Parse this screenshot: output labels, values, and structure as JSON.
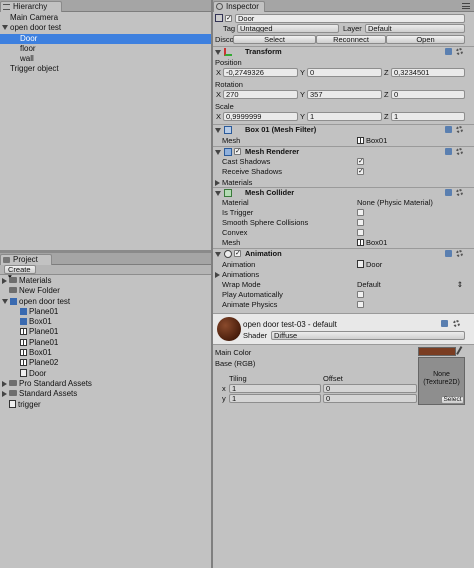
{
  "hierarchy": {
    "tab": "Hierarchy",
    "items": [
      {
        "label": "Main Camera"
      },
      {
        "label": "open door test"
      },
      {
        "label": "Door"
      },
      {
        "label": "floor"
      },
      {
        "label": "wall"
      },
      {
        "label": "Trigger object"
      }
    ]
  },
  "project": {
    "tab": "Project",
    "create_label": "Create",
    "items": [
      {
        "label": "Materials"
      },
      {
        "label": "New Folder"
      },
      {
        "label": "open door test"
      },
      {
        "label": "Plane01"
      },
      {
        "label": "Box01"
      },
      {
        "label": "Plane01"
      },
      {
        "label": "Plane01"
      },
      {
        "label": "Box01"
      },
      {
        "label": "Plane02"
      },
      {
        "label": "Door"
      },
      {
        "label": "Pro Standard Assets"
      },
      {
        "label": "Standard Assets"
      },
      {
        "label": "trigger"
      }
    ]
  },
  "inspector": {
    "tab": "Inspector",
    "object_name": "Door",
    "tag_label": "Tag",
    "tag_value": "Untagged",
    "layer_label": "Layer",
    "layer_value": "Default",
    "discon_label": "Discor",
    "select_btn": "Select",
    "reconnect_btn": "Reconnect",
    "open_btn": "Open",
    "transform": {
      "title": "Transform",
      "position_label": "Position",
      "rotation_label": "Rotation",
      "scale_label": "Scale",
      "x": "X",
      "y": "Y",
      "z": "Z",
      "pos_x": "-0,2749326",
      "pos_y": "0",
      "pos_z": "0,3234501",
      "rot_x": "270",
      "rot_y": "357",
      "rot_z": "0",
      "scl_x": "0,9999999",
      "scl_y": "1",
      "scl_z": "1"
    },
    "mesh_filter": {
      "title": "Box 01 (Mesh Filter)",
      "mesh_label": "Mesh",
      "mesh_value": "Box01"
    },
    "mesh_renderer": {
      "title": "Mesh Renderer",
      "cast_label": "Cast Shadows",
      "cast_check": "✓",
      "receive_label": "Receive Shadows",
      "receive_check": "✓",
      "materials_label": "Materials"
    },
    "mesh_collider": {
      "title": "Mesh Collider",
      "material_label": "Material",
      "material_value": "None (Physic Material)",
      "trigger_label": "Is Trigger",
      "smooth_label": "Smooth Sphere Collisions",
      "convex_label": "Convex",
      "mesh_label": "Mesh",
      "mesh_value": "Box01"
    },
    "animation": {
      "title": "Animation",
      "animation_label": "Animation",
      "animation_value": "Door",
      "animations_label": "Animations",
      "wrap_label": "Wrap Mode",
      "wrap_value": "Default",
      "play_label": "Play Automatically",
      "physics_label": "Animate Physics"
    },
    "material": {
      "title": "open door test-03 - default",
      "shader_label": "Shader",
      "shader_value": "Diffuse",
      "main_color_label": "Main Color",
      "main_color_hex": "#7a3d22",
      "base_label": "Base (RGB)",
      "tiling_label": "Tiling",
      "offset_label": "Offset",
      "x": "x",
      "y": "y",
      "tiling_x": "1",
      "tiling_y": "1",
      "offset_x": "0",
      "offset_y": "0",
      "tex_none": "None",
      "tex_type": "(Texture2D)",
      "tex_select": "Select"
    }
  },
  "colors": {
    "selection": "#3d80df",
    "panel": "#c2c2c2"
  }
}
